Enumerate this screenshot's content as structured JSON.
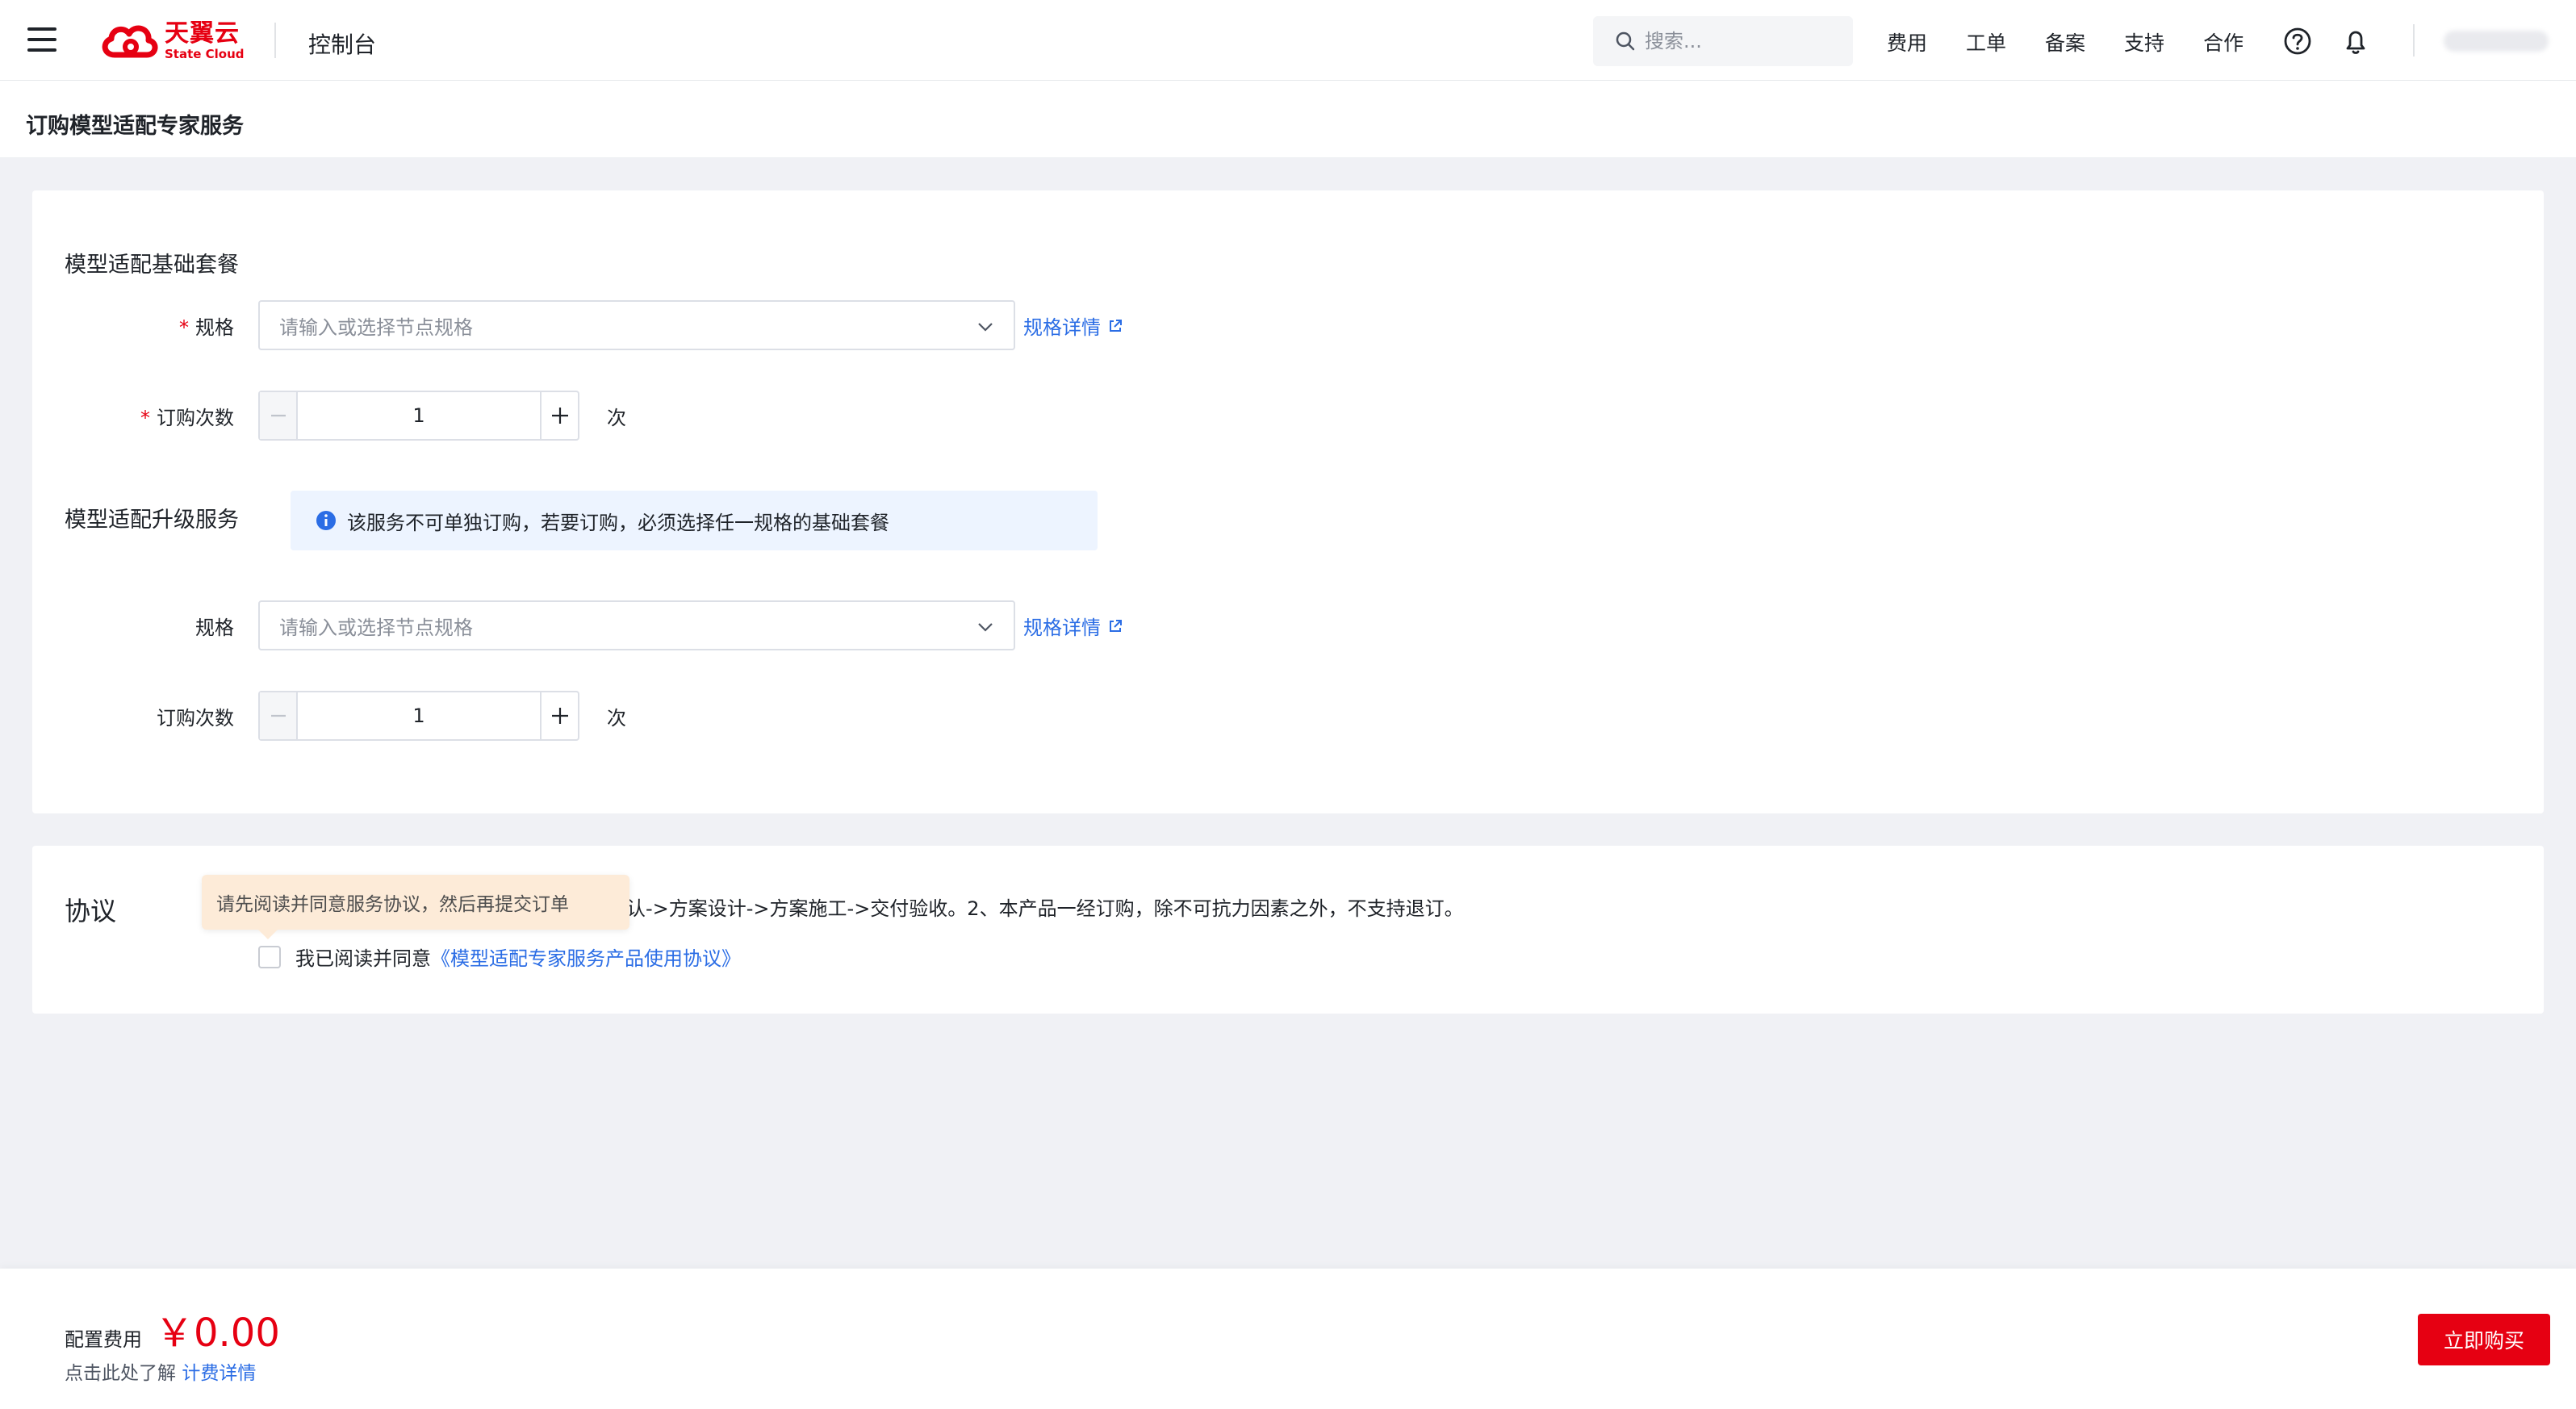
{
  "header": {
    "logo_cn": "天翼云",
    "logo_en": "State Cloud",
    "console": "控制台",
    "search_placeholder": "搜索...",
    "nav": [
      "费用",
      "工单",
      "备案",
      "支持",
      "合作"
    ]
  },
  "page": {
    "title": "订购模型适配专家服务"
  },
  "basic": {
    "section_title": "模型适配基础套餐",
    "spec_label": "规格",
    "spec_placeholder": "请输入或选择节点规格",
    "spec_link": "规格详情",
    "qty_label": "订购次数",
    "qty_value": "1",
    "qty_unit": "次"
  },
  "upgrade": {
    "section_title": "模型适配升级服务",
    "notice": "该服务不可单独订购，若要订购，必须选择任一规格的基础套餐",
    "spec_label": "规格",
    "spec_placeholder": "请输入或选择节点规格",
    "spec_link": "规格详情",
    "qty_label": "订购次数",
    "qty_value": "1",
    "qty_unit": "次"
  },
  "agreement": {
    "title": "协议",
    "tooltip": "请先阅读并同意服务协议，然后再提交订单",
    "text_visible": "求沟通确认->方案设计->方案施工->交付验收。2、本产品一经订购，除不可抗力因素之外，不支持退订。",
    "checkbox_label": "我已阅读并同意",
    "link_text": "《模型适配专家服务产品使用协议》"
  },
  "footer": {
    "fee_label": "配置费用",
    "fee_amount": "￥0.00",
    "note_prefix": "点击此处了解",
    "note_link": "计费详情",
    "buy_button": "立即购买"
  },
  "colors": {
    "brand_red": "#e60012",
    "link_blue": "#2b6de5",
    "info_bg": "#edf4ff",
    "tooltip_bg": "#fdebd8"
  }
}
